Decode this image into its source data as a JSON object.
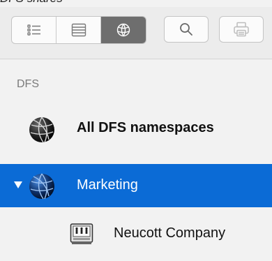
{
  "window": {
    "title": "DFS shares"
  },
  "toolbar": {
    "view_buttons": [
      {
        "icon": "list-view-icon",
        "active": false
      },
      {
        "icon": "column-view-icon",
        "active": false
      },
      {
        "icon": "globe-view-icon",
        "active": true
      }
    ],
    "search_icon": "search-icon",
    "print_icon": "print-icon"
  },
  "sidebar": {
    "section_label": "DFS",
    "items": [
      {
        "label": "All DFS namespaces",
        "icon": "dfs-globe-icon",
        "selected": false,
        "bold": true
      },
      {
        "label": "Marketing",
        "icon": "dfs-globe-icon",
        "selected": true,
        "expanded": true
      },
      {
        "label": "Neucott Company",
        "icon": "server-share-icon",
        "selected": false
      }
    ]
  },
  "colors": {
    "selection": "#0b6bd6",
    "toolbar_active": "#6e6e6e",
    "section_label": "#7a7a7a"
  }
}
